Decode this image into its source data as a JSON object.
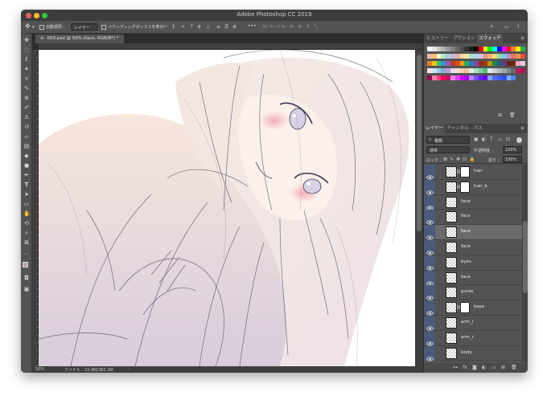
{
  "app": {
    "title": "Adobe Photoshop CC 2019"
  },
  "options_bar": {
    "auto_select_label": "自動選択 :",
    "auto_select_target": "レイヤー",
    "show_transform_label": "バウンディングボックスを表示",
    "mode_3d_label": "3D モード :"
  },
  "document": {
    "tab_title": "003.psd @ 50% (face, RGB/8*) *"
  },
  "ruler_h_ticks": [
    "800",
    "700",
    "600",
    "500",
    "400",
    "300",
    "200",
    "100",
    "0",
    "100",
    "200",
    "300",
    "400",
    "500",
    "600",
    "700",
    "800",
    "900",
    "1000",
    "1100",
    "1200",
    "1300",
    "1400",
    "1500",
    "1600"
  ],
  "status": {
    "zoom": "50%",
    "file_info": "ファイル : 33.9M/360.3M"
  },
  "swatches_panel": {
    "tabs": [
      "ヒストリー",
      "アクション",
      "スウォッチ"
    ],
    "active_tab": "スウォッチ",
    "colors": [
      "#ffffff",
      "#e6e6e6",
      "#cccccc",
      "#b3b3b3",
      "#999999",
      "#808080",
      "#666666",
      "#4d4d4d",
      "#333333",
      "#1a1a1a",
      "#000000",
      "#ff0000",
      "#ffff00",
      "#00ff00",
      "#00ffff",
      "#0000ff",
      "#ff00ff",
      "#ed1c24",
      "#ff7f27",
      "#fff200",
      "#22b14c",
      "#f5b7b1",
      "#f8c471",
      "#fcf3cf",
      "#abebc6",
      "#a9cce3",
      "#d2b4de",
      "#e6b0aa",
      "#fad7a0",
      "#f9e79f",
      "#a3e4d7",
      "#aed6f1",
      "#d7bde2",
      "#f1948a",
      "#f0b27a",
      "#f7dc6f",
      "#82e0aa",
      "#85c1e9",
      "#bb8fce",
      "#ec7063",
      "#eb984e",
      "#e74c3c",
      "#e67e22",
      "#f1c40f",
      "#2ecc71",
      "#3498db",
      "#9b59b6",
      "#c0392b",
      "#d35400",
      "#f39c12",
      "#27ae60",
      "#2980b9",
      "#8e44ad",
      "#922b21",
      "#a04000",
      "#b7950b",
      "#1e8449",
      "#1f618d",
      "#6c3483",
      "#641e16",
      "#6e2c00",
      "#f4a6c0",
      "#f7c6d9",
      "#fbe3ec",
      "#c9e4f5",
      "#9fcbe9",
      "#7fb3d5",
      "#c39bd3",
      "#e8daef",
      "#fde2d0",
      "#fbd1b7",
      "#f9c0a0",
      "#d5f5e3",
      "#a9dfbf",
      "#7dcea0",
      "#52be80",
      "#e5e8e8",
      "#ccd1d1",
      "#b2babb",
      "#99a3a4",
      "#7f8c8d",
      "#616a6b",
      "#c2185b",
      "#ad1457",
      "#880e4f",
      "#ff80ab",
      "#ff4081",
      "#f50057",
      "#c51162",
      "#ea80fc",
      "#e040fb",
      "#d500f9",
      "#aa00ff",
      "#b388ff",
      "#7c4dff",
      "#651fff",
      "#6200ea",
      "#8c9eff",
      "#536dfe",
      "#3d5afe",
      "#304ffe",
      "#82b1ff",
      "#448aff"
    ]
  },
  "layers_panel": {
    "tabs": [
      "レイヤー",
      "チャンネル",
      "パス"
    ],
    "active_tab": "レイヤー",
    "kind_label": "種類",
    "blend_mode": "通常",
    "opacity_label": "不透明度 :",
    "opacity_value": "100%",
    "lock_label": "ロック :",
    "fill_label": "塗り :",
    "fill_value": "100%",
    "layers": [
      {
        "name": "hair",
        "mask": true,
        "selected": false
      },
      {
        "name": "hair_b",
        "mask": true,
        "selected": false
      },
      {
        "name": "face",
        "mask": false,
        "selected": false
      },
      {
        "name": "face",
        "mask": false,
        "selected": false
      },
      {
        "name": "face",
        "mask": false,
        "selected": true
      },
      {
        "name": "face",
        "mask": false,
        "selected": false
      },
      {
        "name": "eyes",
        "mask": false,
        "selected": false
      },
      {
        "name": "face",
        "mask": false,
        "selected": false
      },
      {
        "name": "guide",
        "mask": false,
        "selected": false
      },
      {
        "name": "base",
        "mask": true,
        "selected": false
      },
      {
        "name": "arm_l",
        "mask": false,
        "selected": false
      },
      {
        "name": "arm_r",
        "mask": false,
        "selected": false
      },
      {
        "name": "body",
        "mask": false,
        "selected": false
      }
    ]
  }
}
